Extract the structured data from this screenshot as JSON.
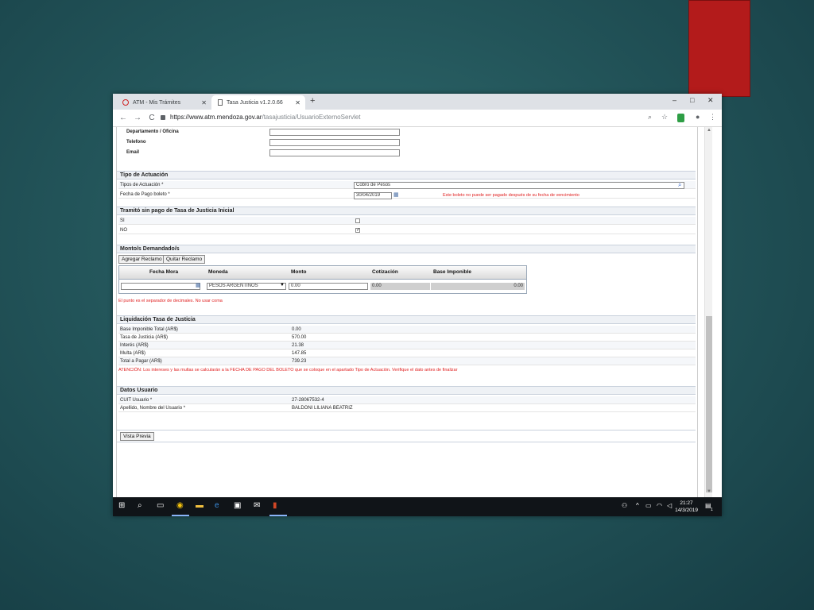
{
  "browser": {
    "tabs": [
      {
        "label": "ATM - Mis Trámites",
        "icon": "atm-icon"
      },
      {
        "label": "Tasa Justicia v1.2.0.66",
        "icon": "document-icon"
      }
    ],
    "new_tab": "+",
    "window_controls": {
      "minimize": "–",
      "maximize": "□",
      "close": "✕"
    },
    "nav": {
      "back": "←",
      "forward": "→",
      "reload": "C"
    },
    "url_host": "https://www.atm.mendoza.gov.ar",
    "url_path": "/tasajusticia/UsuarioExternoServlet"
  },
  "top_fields": [
    {
      "label": "Departamento / Oficina"
    },
    {
      "label": "Telefono"
    },
    {
      "label": "Email"
    }
  ],
  "tipo_actuacion": {
    "section_title": "Tipo de Actuación",
    "tipo_label": "Tipos de Actuación *",
    "tipo_value": "Cobro de Pesos",
    "fecha_label": "Fecha de Pago boleto *",
    "fecha_value": "30/04/2019",
    "fecha_warning": "Este boleto no puede ser pagado después de su fecha de vencimiento"
  },
  "tramite": {
    "section_title": "Tramitó sin pago de Tasa de Justicia Inicial",
    "si_label": "SI",
    "no_label": "NO",
    "si_checked": false,
    "no_checked": true,
    "checkmark": "✓"
  },
  "montos": {
    "section_title": "Monto/s Demandado/s",
    "add_button": "Agregar Reclamo",
    "remove_button": "Quitar Reclamo",
    "columns": [
      "Fecha Mora",
      "Moneda",
      "Monto",
      "Cotización",
      "Base Imponible"
    ],
    "row": {
      "fecha_mora": "",
      "moneda": "PESOS ARGENTINOS",
      "monto": "0.00",
      "cotizacion": "0.00",
      "base_imponible": "0.00"
    },
    "note": "El punto es el separador de decimales. No usar coma"
  },
  "liquidacion": {
    "section_title": "Liquidación Tasa de Justicia",
    "rows": [
      {
        "label": "Base Imponible Total (AR$)",
        "value": "0.00"
      },
      {
        "label": "Tasa de Justicia (AR$)",
        "value": "570.00"
      },
      {
        "label": "Interés (AR$)",
        "value": "21.38"
      },
      {
        "label": "Multa (AR$)",
        "value": "147.85"
      },
      {
        "label": "Total a Pagar (AR$)",
        "value": "739.23"
      }
    ],
    "warning": "ATENCIÓN: Los intereses y las multas se calcularán a la FECHA DE PAGO DEL BOLETO que se coloque en el apartado Tipo de Actuación. Verifique el dato antes de finalizar"
  },
  "usuario": {
    "section_title": "Datos Usuario",
    "rows": [
      {
        "label": "CUIT Usuario *",
        "value": "27-28067532-4"
      },
      {
        "label": "Apellido, Nombre del Usuario *",
        "value": "BALDONI LILIANA BEATRIZ"
      }
    ]
  },
  "preview_button": "Vista Previa",
  "taskbar": {
    "time": "21:27",
    "date": "14/3/2019",
    "notification_count": "1"
  },
  "colors": {
    "accent_red": "#b31b1b",
    "warning_red": "#e02020"
  }
}
